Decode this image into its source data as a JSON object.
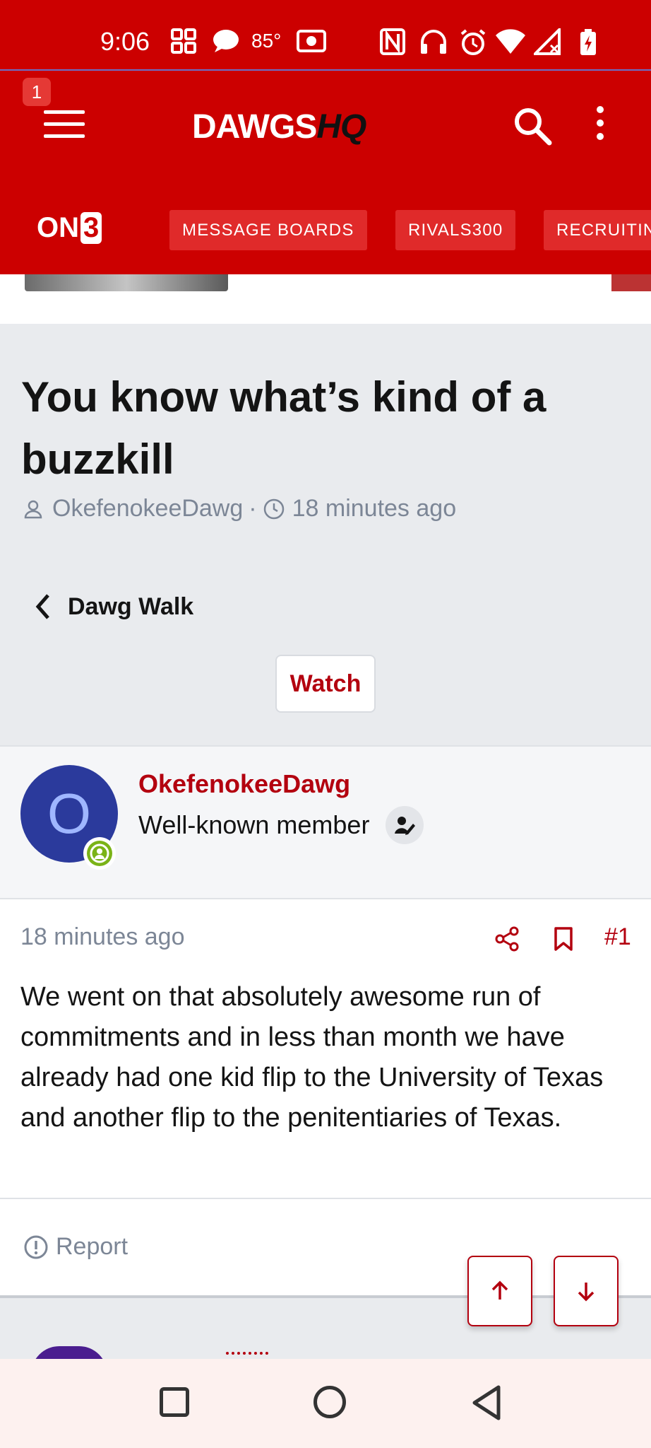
{
  "status_bar": {
    "time": "9:06",
    "temperature": "85°",
    "icons": [
      "grid-icon",
      "chat-bubble-icon",
      "radio-icon",
      "nfc-icon",
      "headphones-icon",
      "alarm-icon",
      "wifi-icon",
      "signal-icon",
      "battery-charging-icon"
    ]
  },
  "header": {
    "notification_count": "1",
    "logo_part1": "DAWGS",
    "logo_part2": "HQ",
    "on3_part1": "ON",
    "on3_part2": "3",
    "nav": [
      "MESSAGE BOARDS",
      "RIVALS300",
      "RECRUITIN"
    ]
  },
  "thread": {
    "title": "You know what’s kind of a buzzkill",
    "author": "OkefenokeeDawg",
    "meta_separator": "·",
    "time": "18 minutes ago",
    "forum": "Dawg Walk",
    "watch_label": "Watch"
  },
  "post": {
    "avatar_letter": "O",
    "username": "OkefenokeeDawg",
    "user_title": "Well-known member",
    "time": "18 minutes ago",
    "number": "#1",
    "body": "We went on that absolutely awesome run of commitments and in less than month we have already had one kid flip to the University of Texas and another flip to the penitentiaries of Texas.",
    "report_label": "Report"
  },
  "colors": {
    "brand_red": "#cc0000",
    "link_red": "#b3000f",
    "avatar_blue": "#2b3a9c",
    "online_green": "#7ab317"
  }
}
